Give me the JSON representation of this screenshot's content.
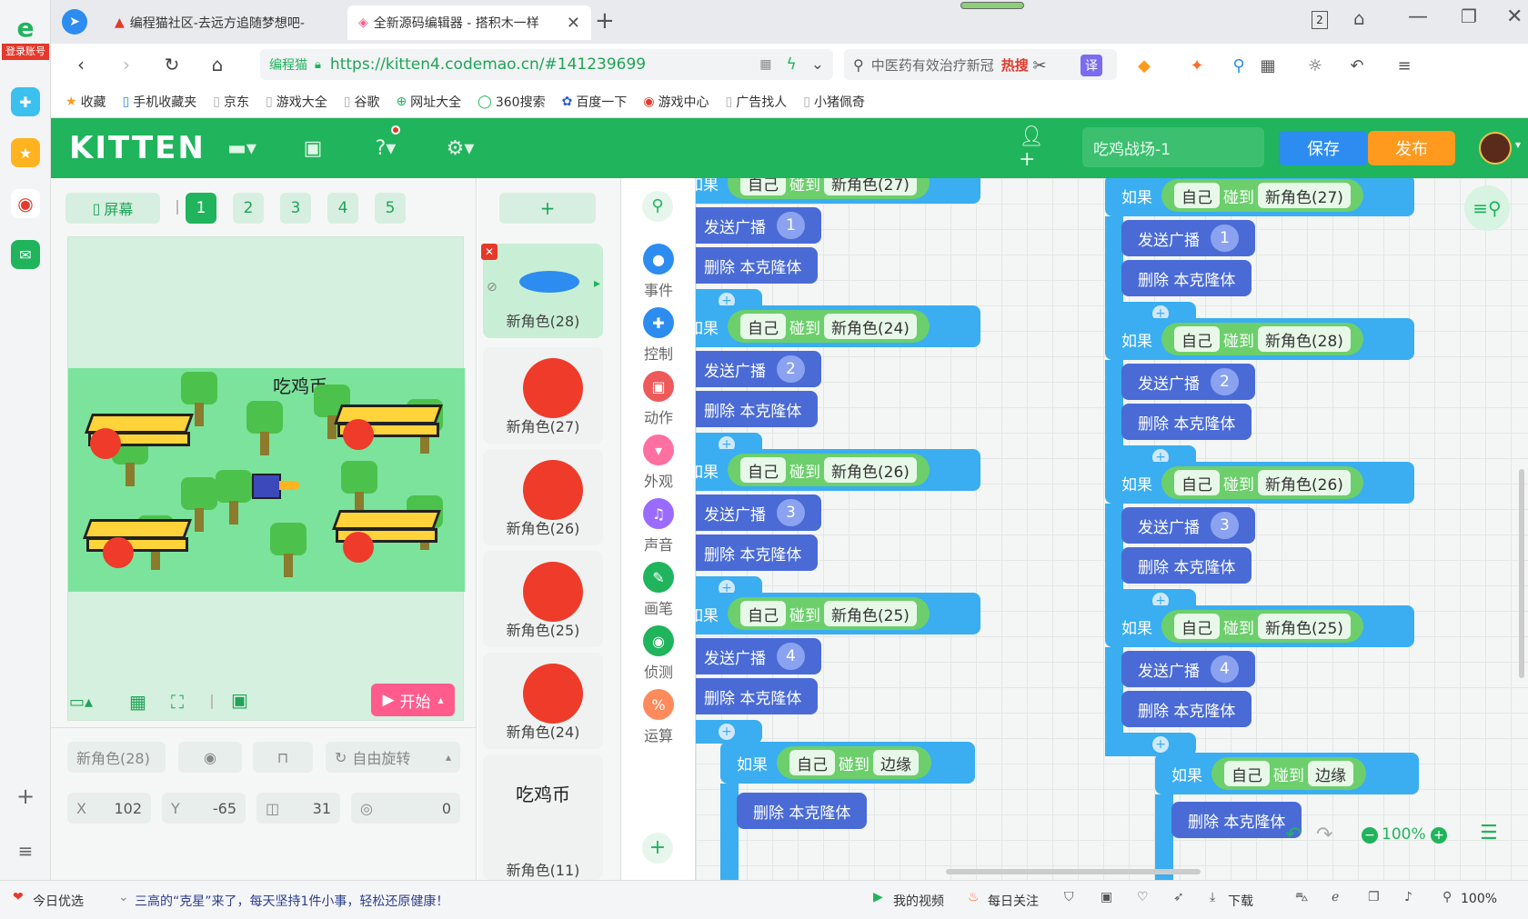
{
  "left_rail": {
    "login_label": "登录账号"
  },
  "tabs": [
    {
      "label": "编程猫社区-去远方追随梦想吧-"
    },
    {
      "label": "全新源码编辑器 - 搭积木一样"
    }
  ],
  "tab_count": "2",
  "address": {
    "site_badge": "编程猫",
    "url": "https://kitten4.codemao.cn/#141239699"
  },
  "search": {
    "placeholder": "中医药有效治疗新冠",
    "hot": "热搜"
  },
  "bookmarks": [
    {
      "label": "收藏"
    },
    {
      "label": "手机收藏夹"
    },
    {
      "label": "京东"
    },
    {
      "label": "游戏大全"
    },
    {
      "label": "谷歌"
    },
    {
      "label": "网址大全"
    },
    {
      "label": "360搜索"
    },
    {
      "label": "百度一下"
    },
    {
      "label": "游戏中心"
    },
    {
      "label": "广告找人"
    },
    {
      "label": "小猪佩奇"
    }
  ],
  "app": {
    "logo": "KITTEN",
    "project_name": "吃鸡战场-1",
    "save": "保存",
    "publish": "发布",
    "colors": {
      "brand": "#20b45c",
      "save": "#2d8cf0",
      "publish": "#ff9a1f"
    }
  },
  "stage": {
    "screen_btn": "屏幕",
    "scenes": [
      "1",
      "2",
      "3",
      "4",
      "5"
    ],
    "active_scene": "1",
    "game_title": "吃鸡币",
    "start": "开始"
  },
  "props": {
    "sprite_name": "新角色(28)",
    "rotation_mode": "自由旋转",
    "x_label": "X",
    "x": "102",
    "y_label": "Y",
    "y": "-65",
    "size": "31",
    "direction": "0"
  },
  "sprites": [
    {
      "label": "新角色(28)",
      "kind": "ellipse"
    },
    {
      "label": "新角色(27)",
      "kind": "dot"
    },
    {
      "label": "新角色(26)",
      "kind": "dot"
    },
    {
      "label": "新角色(25)",
      "kind": "dot"
    },
    {
      "label": "新角色(24)",
      "kind": "dot"
    },
    {
      "label": "新角色(11)",
      "kind": "text",
      "text": "吃鸡币"
    }
  ],
  "categories": [
    {
      "label": "事件",
      "color": "#2d8cf0"
    },
    {
      "label": "控制",
      "color": "#2d8cf0"
    },
    {
      "label": "动作",
      "color": "#ee5a5a"
    },
    {
      "label": "外观",
      "color": "#ff6f9f"
    },
    {
      "label": "声音",
      "color": "#9b6bff"
    },
    {
      "label": "画笔",
      "color": "#20b45c"
    },
    {
      "label": "侦测",
      "color": "#20b45c"
    },
    {
      "label": "运算",
      "color": "#ff8a5c"
    }
  ],
  "blocks": {
    "if": "如果",
    "self": "自己",
    "touch": "碰到",
    "broadcast": "发送广播",
    "delete_clone": "删除 本克隆体",
    "edge": "边缘",
    "left_column": [
      {
        "target": "新角色(27)",
        "msg": "1"
      },
      {
        "target": "新角色(24)",
        "msg": "2"
      },
      {
        "target": "新角色(26)",
        "msg": "3"
      },
      {
        "target": "新角色(25)",
        "msg": "4"
      }
    ],
    "right_column": [
      {
        "target": "新角色(27)",
        "msg": "1"
      },
      {
        "target": "新角色(28)",
        "msg": "2"
      },
      {
        "target": "新角色(26)",
        "msg": "3"
      },
      {
        "target": "新角色(25)",
        "msg": "4"
      }
    ]
  },
  "zoom": "100%",
  "statusbar": {
    "today": "今日优选",
    "news": "三高的“克星”来了，每天坚持1件小事，轻松还原健康！",
    "video": "我的视频",
    "daily": "每日关注",
    "download": "下载",
    "zoom": "100%"
  }
}
